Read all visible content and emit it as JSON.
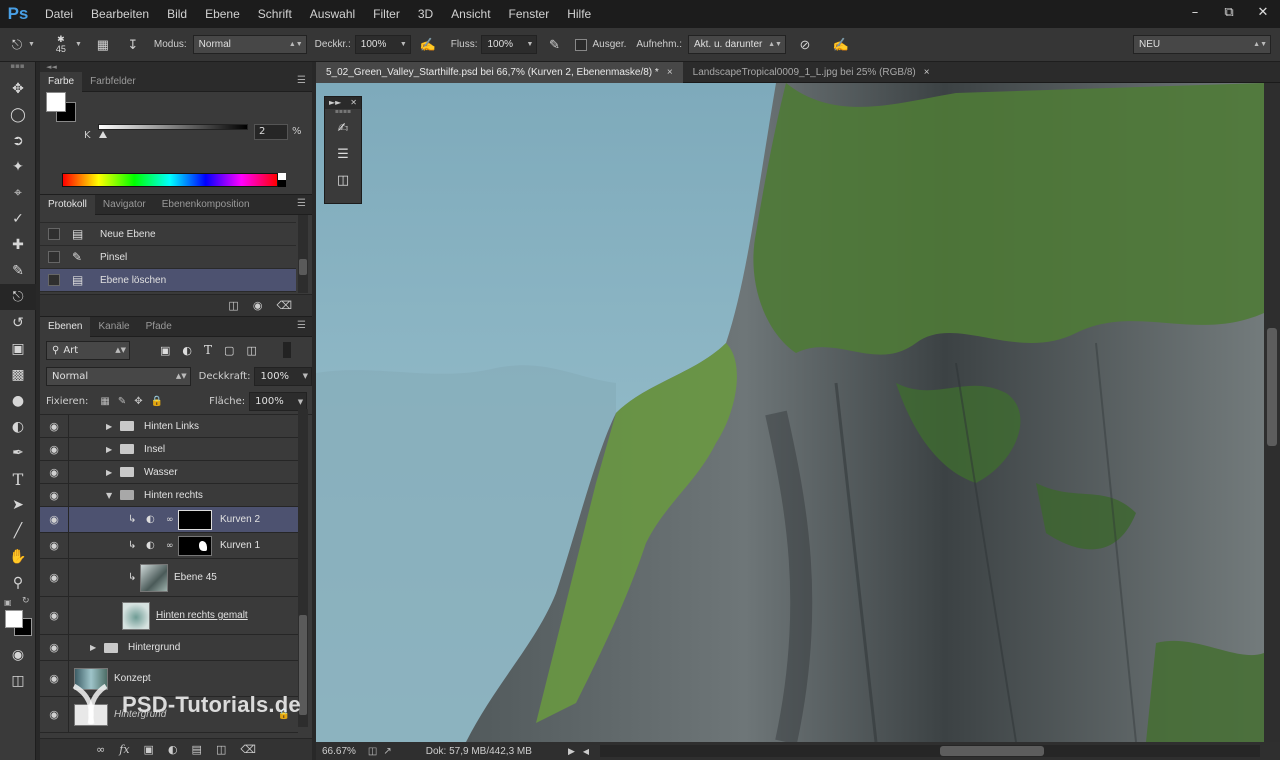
{
  "menubar": {
    "logo": "Ps",
    "items": [
      "Datei",
      "Bearbeiten",
      "Bild",
      "Ebene",
      "Schrift",
      "Auswahl",
      "Filter",
      "3D",
      "Ansicht",
      "Fenster",
      "Hilfe"
    ]
  },
  "options": {
    "brush_size": "45",
    "modus_label": "Modus:",
    "modus_value": "Normal",
    "deckkr_label": "Deckkr.:",
    "deckkr_value": "100%",
    "fluss_label": "Fluss:",
    "fluss_value": "100%",
    "ausger_label": "Ausger.",
    "aufnehm_label": "Aufnehm.:",
    "aufnehm_value": "Akt. u. darunter",
    "preset_value": "NEU"
  },
  "color_panel": {
    "tabs": [
      "Farbe",
      "Farbfelder"
    ],
    "channel_label": "K",
    "value": "2",
    "unit": "%"
  },
  "history_panel": {
    "tabs": [
      "Protokoll",
      "Navigator",
      "Ebenenkomposition"
    ],
    "items": [
      {
        "label": "Neue Ebene"
      },
      {
        "label": "Pinsel"
      },
      {
        "label": "Ebene löschen"
      }
    ]
  },
  "layers_panel": {
    "tabs": [
      "Ebenen",
      "Kanäle",
      "Pfade"
    ],
    "filter_label": "Art",
    "blend_mode": "Normal",
    "opacity_label": "Deckkraft:",
    "opacity_value": "100%",
    "lock_label": "Fixieren:",
    "fill_label": "Fläche:",
    "fill_value": "100%",
    "layers": [
      {
        "name": "Hinten Links",
        "type": "group"
      },
      {
        "name": "Insel",
        "type": "group"
      },
      {
        "name": "Wasser",
        "type": "group"
      },
      {
        "name": "Hinten rechts",
        "type": "group-open"
      },
      {
        "name": "Kurven 2",
        "type": "adjustment"
      },
      {
        "name": "Kurven 1",
        "type": "adjustment"
      },
      {
        "name": "Ebene 45",
        "type": "pixel"
      },
      {
        "name": "Hinten rechts gemalt",
        "type": "pixel"
      },
      {
        "name": "Hintergrund",
        "type": "group"
      },
      {
        "name": "Konzept",
        "type": "pixel"
      },
      {
        "name": "Hintergrund",
        "type": "locked"
      }
    ]
  },
  "doc_tabs": [
    {
      "label": "5_02_Green_Valley_Starthilfe.psd bei 66,7% (Kurven 2, Ebenenmaske/8) *",
      "close": "×"
    },
    {
      "label": "LandscapeTropical0009_1_L.jpg bei 25% (RGB/8)",
      "close": "×"
    }
  ],
  "status": {
    "zoom": "66.67%",
    "doc_info": "Dok: 57,9 MB/442,3 MB"
  },
  "watermark": "PSD-Tutorials.de",
  "colors": {
    "selection": "#4d5270",
    "ps_blue": "#49a0e6",
    "panel_bg": "#3a3a3a"
  }
}
